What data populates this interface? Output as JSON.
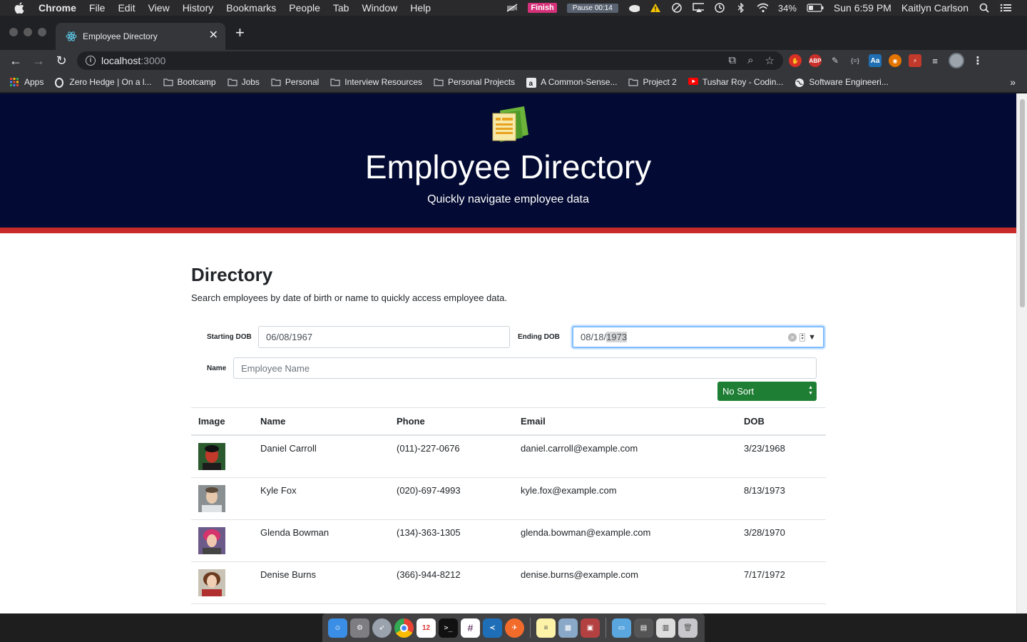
{
  "menubar": {
    "app_name": "Chrome",
    "menus": [
      "File",
      "Edit",
      "View",
      "History",
      "Bookmarks",
      "People",
      "Tab",
      "Window",
      "Help"
    ],
    "recorder_finish": "Finish",
    "recorder_timer": "Pause 00:14",
    "battery": "34%",
    "clock": "Sun 6:59 PM",
    "user": "Kaitlyn Carlson"
  },
  "browser": {
    "tab_title": "Employee Directory",
    "url_host": "localhost",
    "url_port": ":3000"
  },
  "bookmarks": [
    {
      "label": "Apps",
      "icon": "apps-grid-icon"
    },
    {
      "label": "Zero Hedge | On a l...",
      "icon": "zerohedge-icon"
    },
    {
      "label": "Bootcamp",
      "icon": "folder-icon"
    },
    {
      "label": "Jobs",
      "icon": "folder-icon"
    },
    {
      "label": "Personal",
      "icon": "folder-icon"
    },
    {
      "label": "Interview Resources",
      "icon": "folder-icon"
    },
    {
      "label": "Personal Projects",
      "icon": "folder-icon"
    },
    {
      "label": "A Common-Sense...",
      "icon": "amazon-icon"
    },
    {
      "label": "Project 2",
      "icon": "folder-icon"
    },
    {
      "label": "Tushar Roy - Codin...",
      "icon": "youtube-icon"
    },
    {
      "label": "Software Engineeri...",
      "icon": "globe-icon"
    }
  ],
  "hero": {
    "title": "Employee Directory",
    "subtitle": "Quickly navigate employee data"
  },
  "directory": {
    "heading": "Directory",
    "description": "Search employees by date of birth or name to quickly access employee data.",
    "starting_dob_label": "Starting DOB",
    "starting_dob_value": "06/08/1967",
    "ending_dob_label": "Ending DOB",
    "ending_dob_prefix": "08/18/",
    "ending_dob_year": "1973",
    "name_label": "Name",
    "name_placeholder": "Employee Name",
    "sort_value": "No Sort"
  },
  "table": {
    "headers": [
      "Image",
      "Name",
      "Phone",
      "Email",
      "DOB"
    ],
    "rows": [
      {
        "name": "Daniel Carroll",
        "phone": "(011)-227-0676",
        "email": "daniel.carroll@example.com",
        "dob": "3/23/1968"
      },
      {
        "name": "Kyle Fox",
        "phone": "(020)-697-4993",
        "email": "kyle.fox@example.com",
        "dob": "8/13/1973"
      },
      {
        "name": "Glenda Bowman",
        "phone": "(134)-363-1305",
        "email": "glenda.bowman@example.com",
        "dob": "3/28/1970"
      },
      {
        "name": "Denise Burns",
        "phone": "(366)-944-8212",
        "email": "denise.burns@example.com",
        "dob": "7/17/1972"
      }
    ]
  },
  "colors": {
    "hero_bg": "#030a33",
    "hero_stripe": "#c82a2a",
    "sort_button": "#1e7e34"
  }
}
